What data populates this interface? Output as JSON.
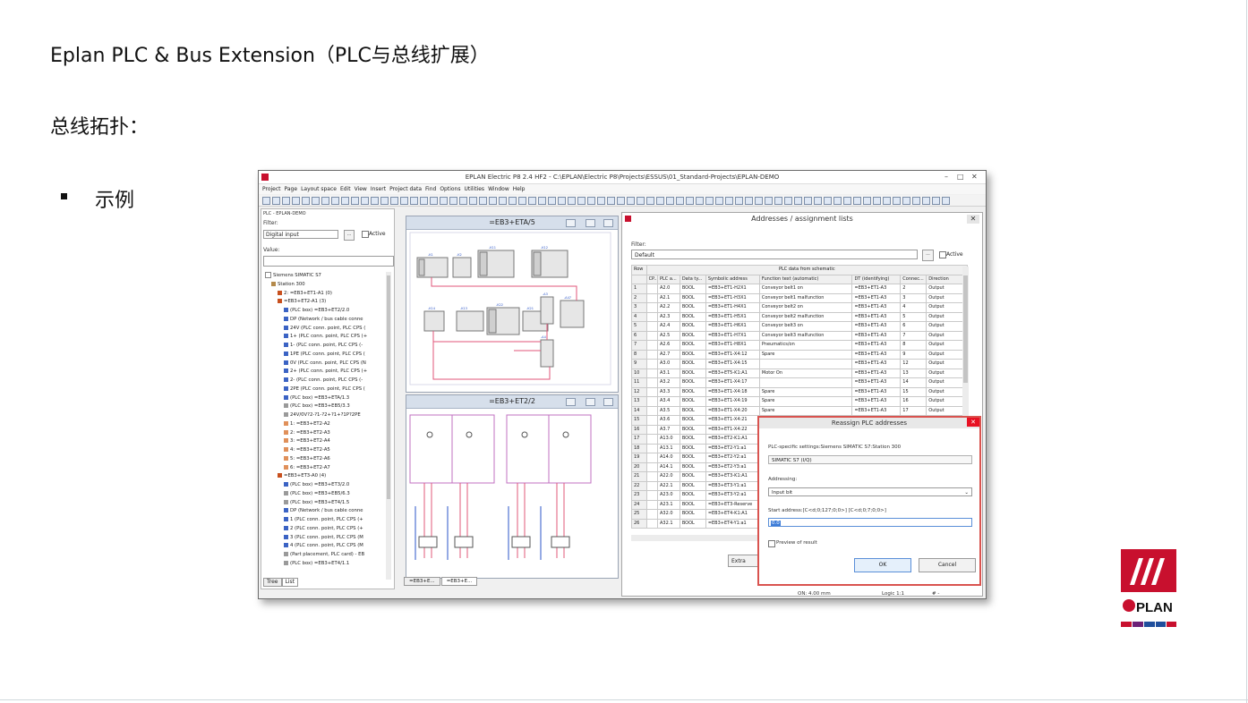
{
  "slide": {
    "title": "Eplan PLC & Bus Extension（PLC与总线扩展）",
    "subtitle": "总线拓扑：",
    "bullet": "示例"
  },
  "window": {
    "title": "EPLAN Electric P8 2.4 HF2 - C:\\EPLAN\\Electric P8\\Projects\\ESSUS\\01_Standard-Projects\\EPLAN-DEMO",
    "menu": [
      "Project",
      "Page",
      "Layout space",
      "Edit",
      "View",
      "Insert",
      "Project data",
      "Find",
      "Options",
      "Utilities",
      "Window",
      "Help"
    ]
  },
  "left_panel": {
    "header": "PLC - EPLAN-DEMO",
    "filter_label": "Filter:",
    "filter_value": "Digital input",
    "filter_btn": "...",
    "active_label": "Active",
    "value_label": "Value:",
    "tree": [
      {
        "indent": 0,
        "icon": "minus",
        "text": "Siemens SIMATIC S7"
      },
      {
        "indent": 1,
        "icon": "station",
        "text": "Station 300"
      },
      {
        "indent": 2,
        "icon": "orange",
        "text": "2: =EB3+ET1-A1 (0)"
      },
      {
        "indent": 2,
        "icon": "orange",
        "text": "=EB3+ET2-A1 (3)"
      },
      {
        "indent": 3,
        "icon": "plc",
        "text": "(PLC box) =EB3+ET2/2.0"
      },
      {
        "indent": 3,
        "icon": "blue",
        "text": "DP (Network / bus cable conne"
      },
      {
        "indent": 3,
        "icon": "blue",
        "text": "24V (PLC conn. point, PLC CPS ("
      },
      {
        "indent": 3,
        "icon": "blue",
        "text": "1+ (PLC conn. point, PLC CPS (+"
      },
      {
        "indent": 3,
        "icon": "blue",
        "text": "1- (PLC conn. point, PLC CPS (-"
      },
      {
        "indent": 3,
        "icon": "blue",
        "text": "1PE (PLC conn. point, PLC CPS ("
      },
      {
        "indent": 3,
        "icon": "blue",
        "text": "0V (PLC conn. point, PLC CPS (N"
      },
      {
        "indent": 3,
        "icon": "blue",
        "text": "2+ (PLC conn. point, PLC CPS (+"
      },
      {
        "indent": 3,
        "icon": "blue",
        "text": "2- (PLC conn. point, PLC CPS (-"
      },
      {
        "indent": 3,
        "icon": "blue",
        "text": "2PE (PLC conn. point, PLC CPS ("
      },
      {
        "indent": 3,
        "icon": "plc",
        "text": "(PLC box) =EB3+ETA/1.3"
      },
      {
        "indent": 3,
        "icon": "gray",
        "text": "(PLC box) =EB3+EB5/3.3"
      },
      {
        "indent": 3,
        "icon": "gray",
        "text": "24V/0V?2-?1-?2+?1+?1P?2PE"
      },
      {
        "indent": 3,
        "icon": "orange2",
        "text": "1: =EB3+ET2-A2"
      },
      {
        "indent": 3,
        "icon": "orange2",
        "text": "2: =EB3+ET2-A3"
      },
      {
        "indent": 3,
        "icon": "orange2",
        "text": "3: =EB3+ET2-A4"
      },
      {
        "indent": 3,
        "icon": "orange2",
        "text": "4: =EB3+ET2-A5"
      },
      {
        "indent": 3,
        "icon": "orange2",
        "text": "5: =EB3+ET2-A6"
      },
      {
        "indent": 3,
        "icon": "orange2",
        "text": "6: =EB3+ET2-A7"
      },
      {
        "indent": 2,
        "icon": "orange",
        "text": "=EB3+ET3-A0 (4)"
      },
      {
        "indent": 3,
        "icon": "plc",
        "text": "(PLC box) =EB3+ET3/2.0"
      },
      {
        "indent": 3,
        "icon": "gray",
        "text": "(PLC box) =EB3+EB5/6.3"
      },
      {
        "indent": 3,
        "icon": "gray",
        "text": "(PLC box) =EB3+ET4/1.5"
      },
      {
        "indent": 3,
        "icon": "blue",
        "text": "DP (Network / bus cable conne"
      },
      {
        "indent": 3,
        "icon": "blue",
        "text": "1 (PLC conn. point, PLC CPS (+"
      },
      {
        "indent": 3,
        "icon": "blue",
        "text": "2 (PLC conn. point, PLC CPS (+"
      },
      {
        "indent": 3,
        "icon": "blue",
        "text": "3 (PLC conn. point, PLC CPS (M"
      },
      {
        "indent": 3,
        "icon": "blue",
        "text": "4 (PLC conn. point, PLC CPS (M"
      },
      {
        "indent": 3,
        "icon": "gray",
        "text": "(Part placement, PLC card) - EB"
      },
      {
        "indent": 3,
        "icon": "gray",
        "text": "(PLC box) =EB3+ET4/1.1"
      }
    ],
    "tabs": [
      "Tree",
      "List"
    ]
  },
  "panes": {
    "top_title": "=EB3+ETA/5",
    "bottom_title": "=EB3+ET2/2",
    "bottom_tabs": [
      "=EB3+E...",
      "=EB3+E..."
    ]
  },
  "addresses_dialog": {
    "title": "Addresses / assignment lists",
    "filter_label": "Filter:",
    "filter_value": "Default",
    "filter_btn": "...",
    "active_label": "Active",
    "group_header": "PLC data from schematic",
    "columns": [
      "Row",
      "CP...",
      "PLC a...",
      "Data ty...",
      "Symbolic address",
      "Function text (automatic)",
      "DT (identifying)",
      "Connec...",
      "Direction"
    ],
    "rows": [
      [
        "1",
        "",
        "A2.0",
        "BOOL",
        "=EB3+ET1-H2X1",
        "Conveyor belt1 on",
        "=EB3+ET1-A3",
        "2",
        "Output"
      ],
      [
        "2",
        "",
        "A2.1",
        "BOOL",
        "=EB3+ET1-H3X1",
        "Conveyor belt1 malfunction",
        "=EB3+ET1-A3",
        "3",
        "Output"
      ],
      [
        "3",
        "",
        "A2.2",
        "BOOL",
        "=EB3+ET1-H4X1",
        "Conveyor belt2 on",
        "=EB3+ET1-A3",
        "4",
        "Output"
      ],
      [
        "4",
        "",
        "A2.3",
        "BOOL",
        "=EB3+ET1-H5X1",
        "Conveyor belt2 malfunction",
        "=EB3+ET1-A3",
        "5",
        "Output"
      ],
      [
        "5",
        "",
        "A2.4",
        "BOOL",
        "=EB3+ET1-H6X1",
        "Conveyor belt3 on",
        "=EB3+ET1-A3",
        "6",
        "Output"
      ],
      [
        "6",
        "",
        "A2.5",
        "BOOL",
        "=EB3+ET1-H7X1",
        "Conveyor belt3 malfunction",
        "=EB3+ET1-A3",
        "7",
        "Output"
      ],
      [
        "7",
        "",
        "A2.6",
        "BOOL",
        "=EB3+ET1-H8X1",
        "Pneumatics/on",
        "=EB3+ET1-A3",
        "8",
        "Output"
      ],
      [
        "8",
        "",
        "A2.7",
        "BOOL",
        "=EB3+ET1-X4:12",
        "Spare",
        "=EB3+ET1-A3",
        "9",
        "Output"
      ],
      [
        "9",
        "",
        "A3.0",
        "BOOL",
        "=EB3+ET1-X4:15",
        "",
        "=EB3+ET1-A3",
        "12",
        "Output"
      ],
      [
        "10",
        "",
        "A3.1",
        "BOOL",
        "=EB3+ET5-K1:A1",
        "Motor On",
        "=EB3+ET1-A3",
        "13",
        "Output"
      ],
      [
        "11",
        "",
        "A3.2",
        "BOOL",
        "=EB3+ET1-X4:17",
        "",
        "=EB3+ET1-A3",
        "14",
        "Output"
      ],
      [
        "12",
        "",
        "A3.3",
        "BOOL",
        "=EB3+ET1-X4:18",
        "Spare",
        "=EB3+ET1-A3",
        "15",
        "Output"
      ],
      [
        "13",
        "",
        "A3.4",
        "BOOL",
        "=EB3+ET1-X4:19",
        "Spare",
        "=EB3+ET1-A3",
        "16",
        "Output"
      ],
      [
        "14",
        "",
        "A3.5",
        "BOOL",
        "=EB3+ET1-X4:20",
        "Spare",
        "=EB3+ET1-A3",
        "17",
        "Output"
      ],
      [
        "15",
        "",
        "A3.6",
        "BOOL",
        "=EB3+ET1-X4:21",
        "",
        "",
        "",
        ""
      ],
      [
        "16",
        "",
        "A3.7",
        "BOOL",
        "=EB3+ET1-X4:22",
        "",
        "",
        "",
        ""
      ],
      [
        "17",
        "",
        "A13.0",
        "BOOL",
        "=EB3+ET2-K1:A1",
        "",
        "",
        "",
        ""
      ],
      [
        "18",
        "",
        "A13.1",
        "BOOL",
        "=EB3+ET2-Y1:a1",
        "",
        "",
        "",
        ""
      ],
      [
        "19",
        "",
        "A14.0",
        "BOOL",
        "=EB3+ET2-Y2:a1",
        "",
        "",
        "",
        ""
      ],
      [
        "20",
        "",
        "A14.1",
        "BOOL",
        "=EB3+ET2-Y3:a1",
        "",
        "",
        "",
        ""
      ],
      [
        "21",
        "",
        "A22.0",
        "BOOL",
        "=EB3+ET3-K1:A1",
        "",
        "",
        "",
        ""
      ],
      [
        "22",
        "",
        "A22.1",
        "BOOL",
        "=EB3+ET3-Y1:a1",
        "",
        "",
        "",
        ""
      ],
      [
        "23",
        "",
        "A23.0",
        "BOOL",
        "=EB3+ET3-Y2:a1",
        "",
        "",
        "",
        ""
      ],
      [
        "24",
        "",
        "A23.1",
        "BOOL",
        "=EB3+ET3-Reserve",
        "",
        "",
        "",
        ""
      ],
      [
        "25",
        "",
        "A32.0",
        "BOOL",
        "=EB3+ET4-K1:A1",
        "",
        "",
        "",
        ""
      ],
      [
        "26",
        "",
        "A32.1",
        "BOOL",
        "=EB3+ET4-Y1:a1",
        "",
        "",
        "",
        ""
      ]
    ],
    "extra_btn": "Extra"
  },
  "status": {
    "on": "ON: 4.00 mm",
    "logic": "Logic 1:1",
    "hash": "# -"
  },
  "reassign_dialog": {
    "title": "Reassign PLC addresses",
    "settings_label": "PLC-specific settings:Siemens SIMATIC S7:Station 300",
    "settings_value": "SIMATIC S7 (I/Q)",
    "addressing_label": "Addressing:",
    "addressing_value": "Input bit",
    "start_label": "Start address:[C<d;0;127;0;0>] [C<d;0;7;0;0>]",
    "start_value": "0.0",
    "preview_label": "Preview of result",
    "ok_label": "OK",
    "cancel_label": "Cancel"
  },
  "logo": {
    "text": "EPLAN",
    "brand_color": "#c8102e"
  }
}
